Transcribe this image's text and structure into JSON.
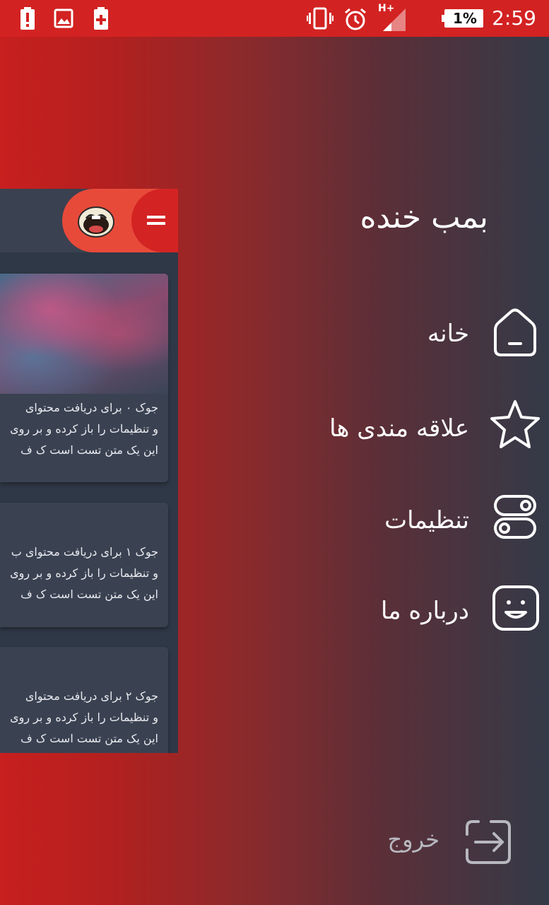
{
  "status_bar": {
    "time": "2:59",
    "battery": "1%",
    "network": "H+",
    "icons": [
      "battery-alert-icon",
      "image-icon",
      "battery-charging-icon",
      "vibrate-icon",
      "alarm-icon",
      "signal-icon"
    ]
  },
  "drawer": {
    "app_title": "بمب خنده",
    "items": [
      {
        "label": "خانه",
        "icon": "home-icon"
      },
      {
        "label": "علاقه مندی ها",
        "icon": "star-icon"
      },
      {
        "label": "تنظیمات",
        "icon": "toggle-icon"
      },
      {
        "label": "درباره ما",
        "icon": "smile-icon"
      }
    ],
    "exit_label": "خروج",
    "exit_icon": "exit-icon"
  },
  "peek": {
    "header_icons": [
      "menu-icon",
      "laughing-face-logo"
    ],
    "cards": [
      {
        "has_image": true,
        "lines": [
          "جوک ۰ برای دریافت محتوای",
          "و تنظیمات را باز کرده و بر روی",
          "این یک متن تست است ک ف"
        ]
      },
      {
        "has_image": false,
        "lines": [
          "جوک ۱ برای دریافت محتوای ب",
          "و تنظیمات را باز کرده و بر روی",
          "این یک متن تست است ک ف"
        ]
      },
      {
        "has_image": false,
        "lines": [
          "جوک ۲ برای دریافت محتوای",
          "و تنظیمات را باز کرده و بر روی",
          "این یک متن تست است ک ف"
        ]
      }
    ]
  },
  "colors": {
    "status_bar": "#d32222",
    "gradient_start": "#c81f1f",
    "gradient_end": "#343a48",
    "header_accent": "#e84a3a",
    "card_bg": "#3a4252",
    "exit_text": "#b8b8bf"
  }
}
